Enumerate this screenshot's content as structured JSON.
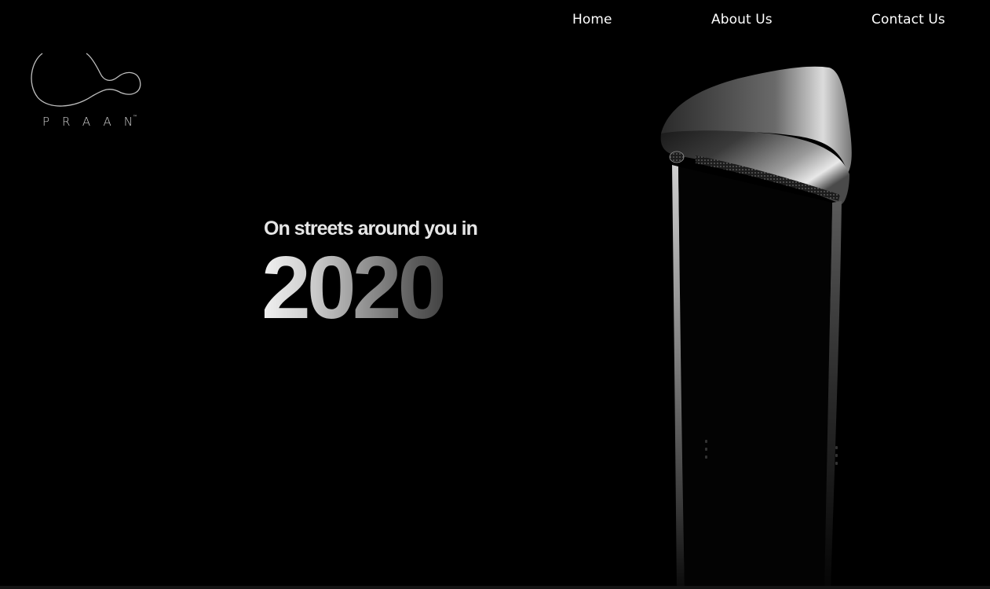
{
  "nav": {
    "home": "Home",
    "about": "About Us",
    "contact": "Contact Us"
  },
  "logo": {
    "wordmark": "PRAAN",
    "trademark": "™"
  },
  "hero": {
    "tagline": "On streets around you in",
    "year": "2020"
  },
  "icons": {
    "logo": "praan-logo-icon",
    "product": "air-purifier-tower-image"
  },
  "colors": {
    "background": "#000000",
    "nav_text": "#ffffff",
    "logo_stroke": "#bfbfbf"
  }
}
